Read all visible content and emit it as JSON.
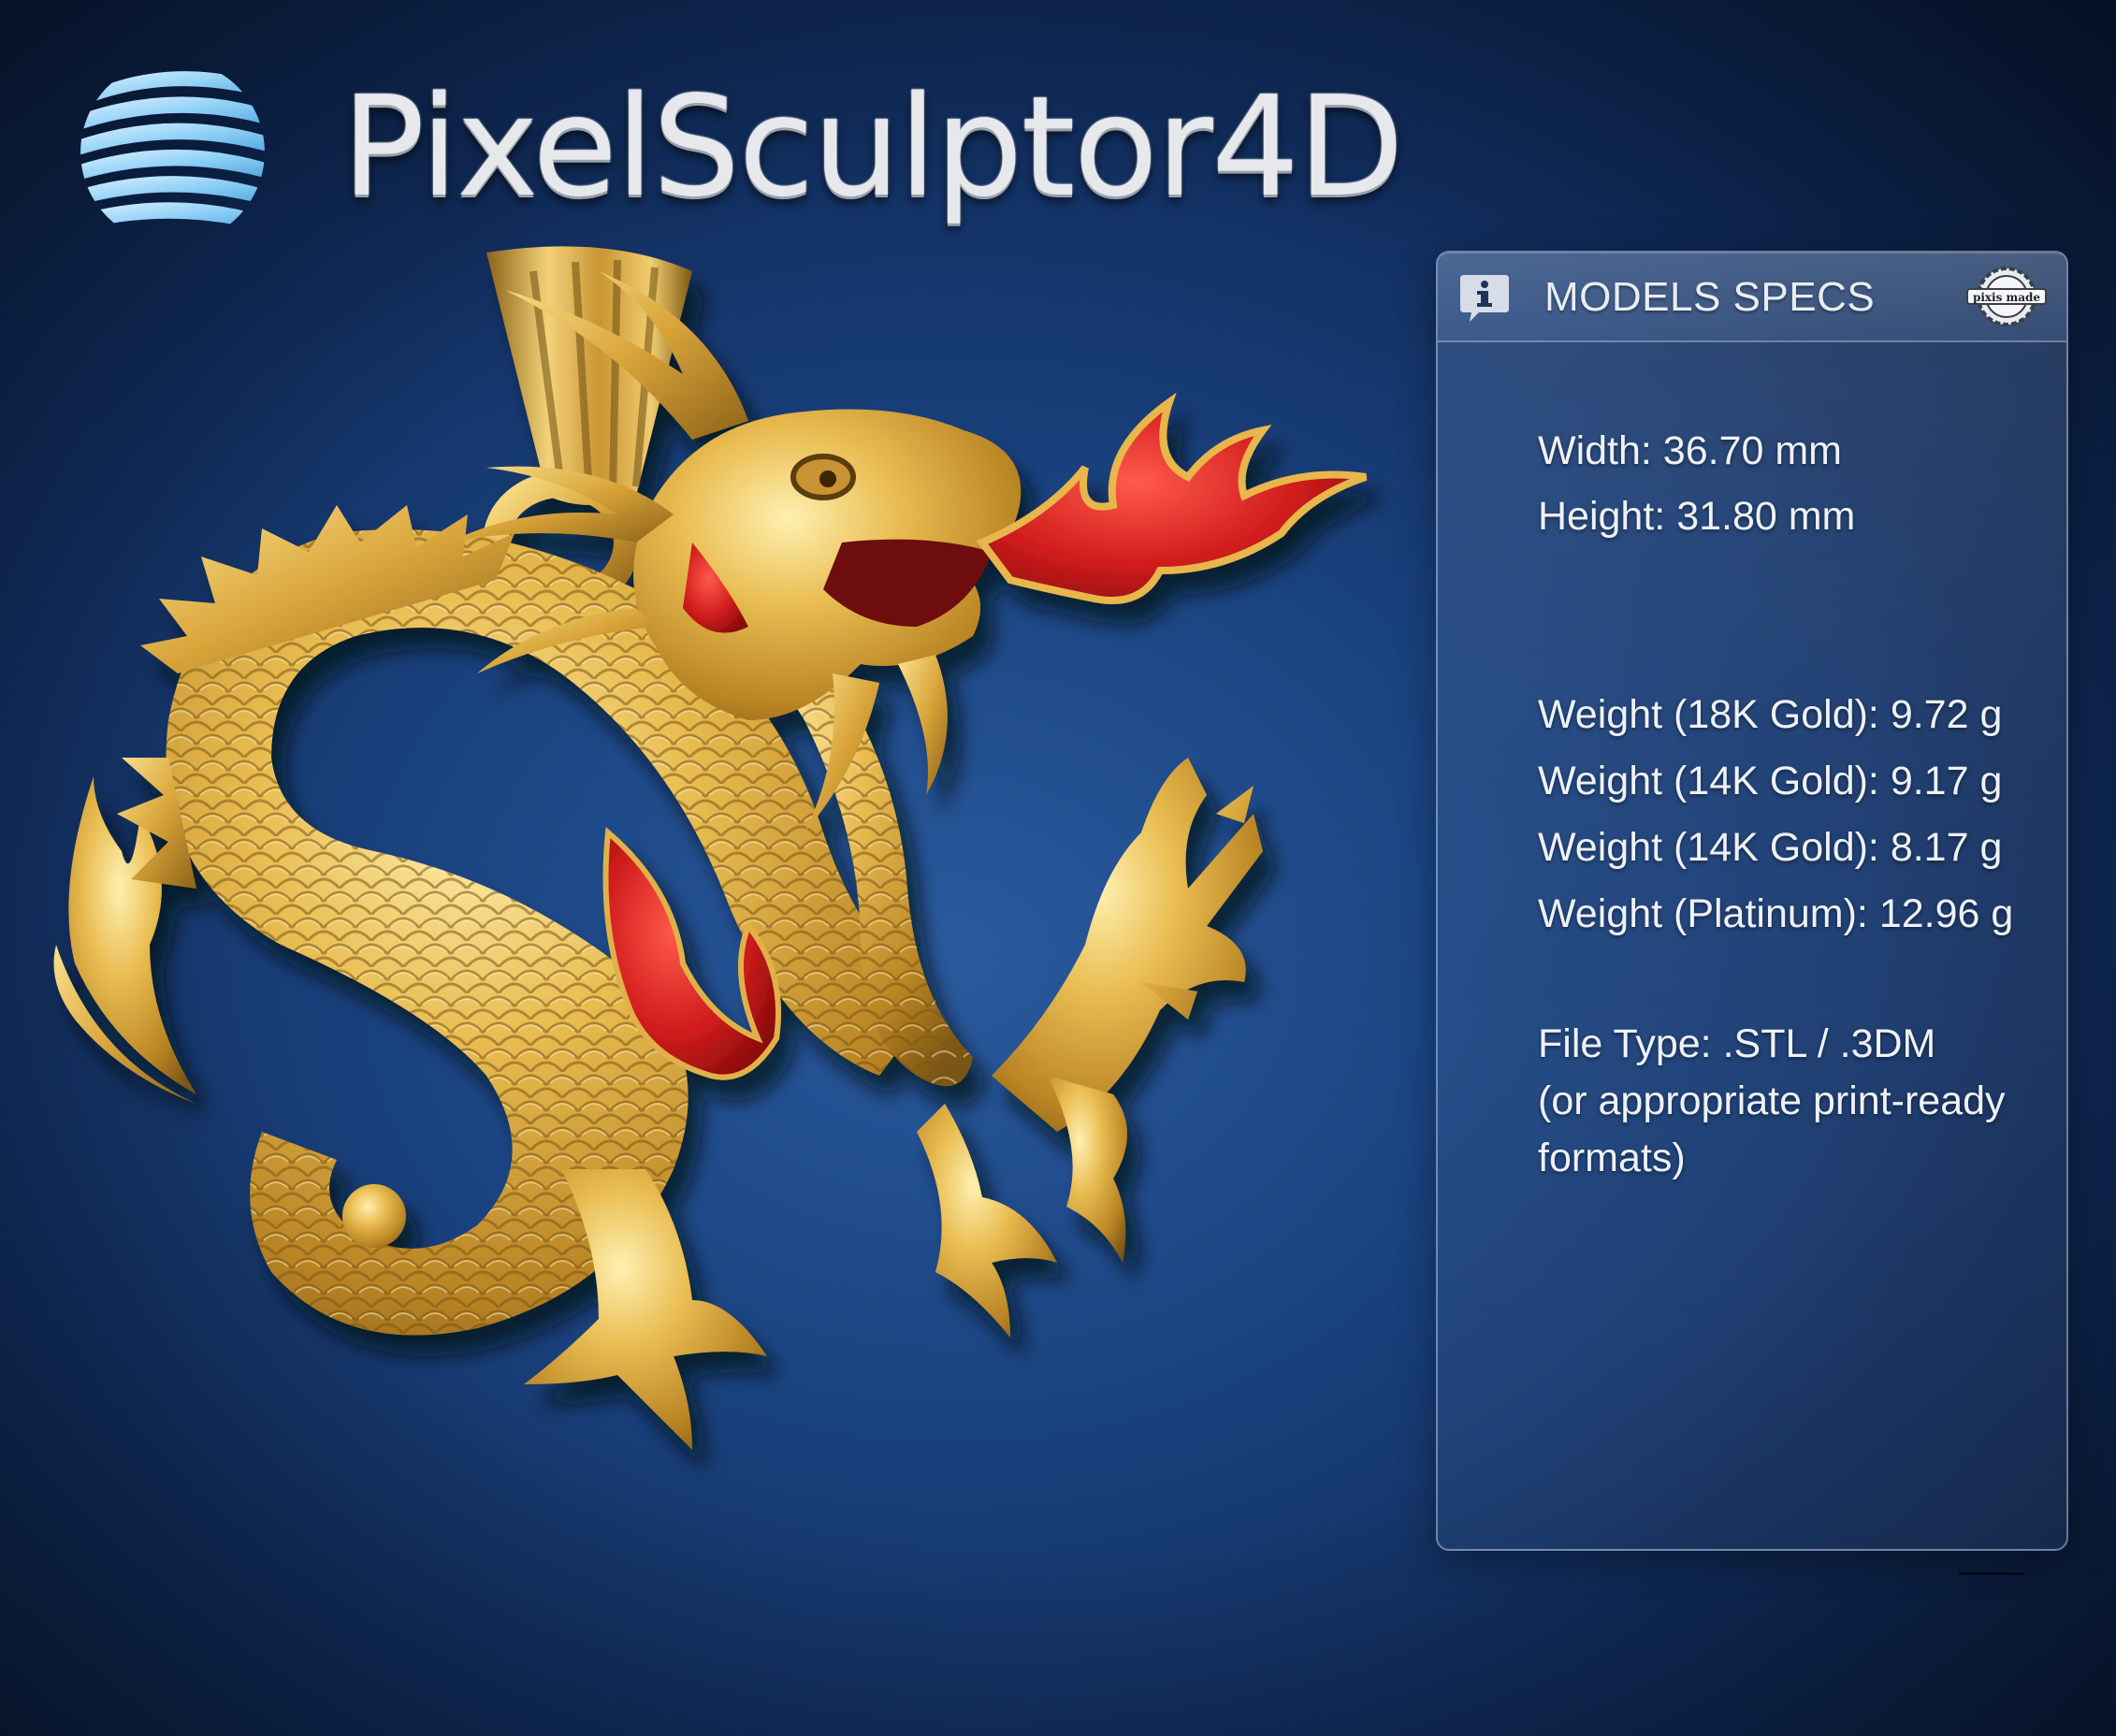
{
  "brand": {
    "name": "PixelSculptor4D",
    "logo_icon": "striped-sphere-logo-icon"
  },
  "artwork": {
    "subject_icon": "dragon-pendant-icon",
    "colors": {
      "gold": "#d9a53a",
      "enamel_red": "#c21818",
      "background": "#1b4583"
    }
  },
  "specs": {
    "title": "MODELS SPECS",
    "info_icon": "info-icon",
    "badge_icon": "pixel-made-badge-icon",
    "badge_text": "pixis made",
    "dimensions": {
      "width": "Width: 36.70 mm",
      "height": "Height: 31.80 mm"
    },
    "weights": [
      "Weight (18K Gold): 9.72 g",
      "Weight (14K Gold): 9.17 g",
      "Weight (14K Gold): 8.17 g",
      "Weight (Platinum): 12.96 g"
    ],
    "file": {
      "line1": "File Type: .STL / .3DM",
      "line2": "(or appropriate print-ready",
      "line3": "formats)"
    }
  }
}
